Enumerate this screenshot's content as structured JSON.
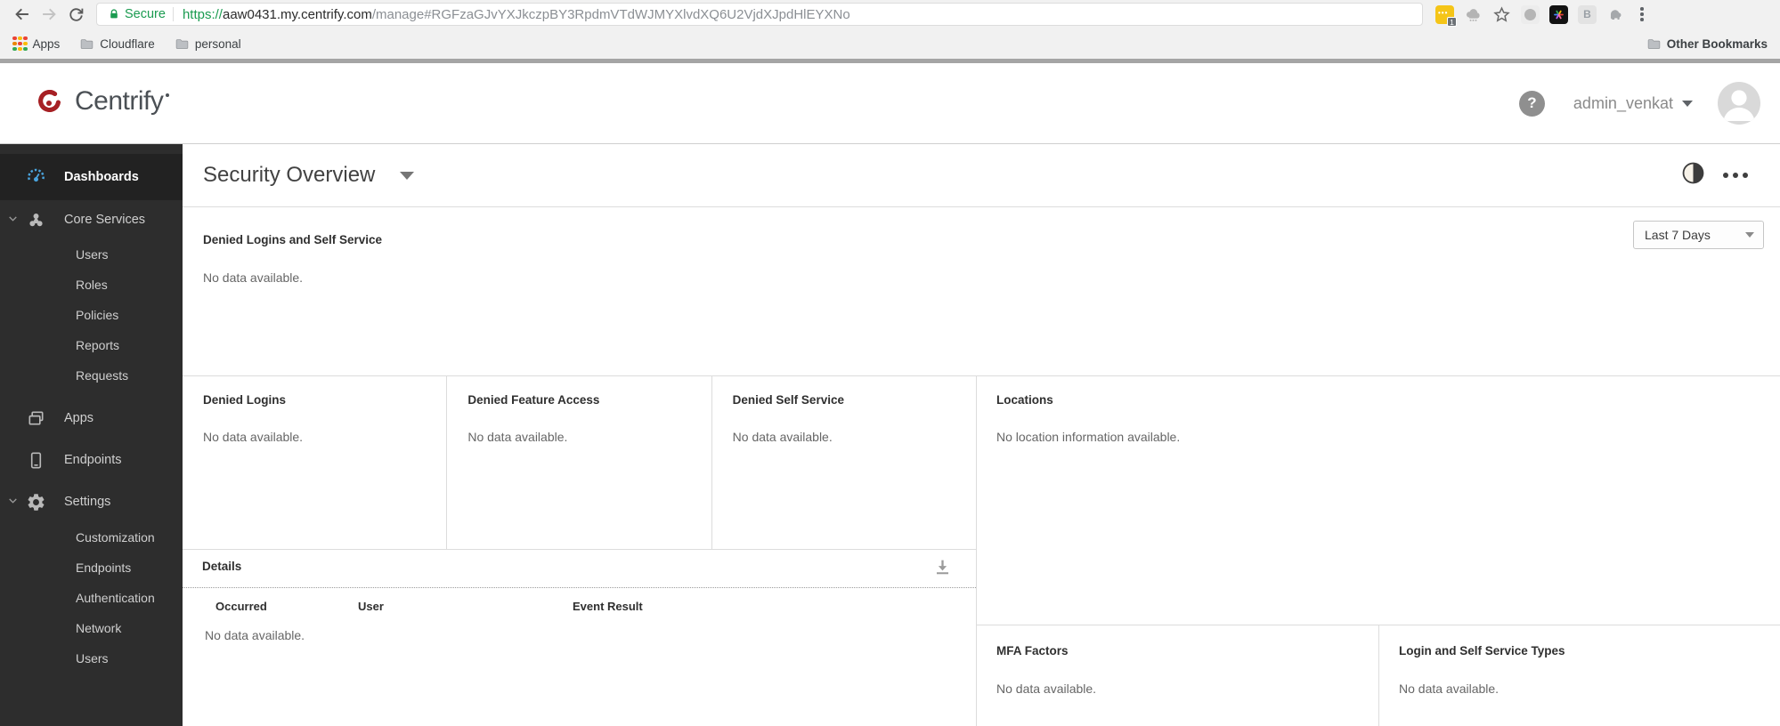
{
  "browser": {
    "secure_label": "Secure",
    "url": {
      "scheme": "https://",
      "host": "aaw0431.my.centrify.com",
      "path": "/manage#RGFzaGJvYXJkczpBY3RpdmVTdWJMYXlvdXQ6U2VjdXJpdHlEYXNo"
    },
    "extensions": {
      "badge_count": "1",
      "b_label": "B"
    },
    "bookmarks_bar": {
      "items": [
        {
          "label": "Apps"
        },
        {
          "label": "Cloudflare"
        },
        {
          "label": "personal"
        }
      ],
      "other_bookmarks_label": "Other Bookmarks"
    }
  },
  "app_header": {
    "brand": "Centrify",
    "help_glyph": "?",
    "username": "admin_venkat"
  },
  "sidebar": {
    "dashboards_label": "Dashboards",
    "core_services": {
      "label": "Core Services",
      "children": [
        "Users",
        "Roles",
        "Policies",
        "Reports",
        "Requests"
      ]
    },
    "apps_label": "Apps",
    "endpoints_label": "Endpoints",
    "settings": {
      "label": "Settings",
      "children": [
        "Customization",
        "Endpoints",
        "Authentication",
        "Network",
        "Users"
      ]
    }
  },
  "main": {
    "title": "Security Overview",
    "denied_logins_self_service": {
      "title": "Denied Logins and Self Service",
      "empty": "No data available.",
      "time_range": "Last 7 Days"
    },
    "mini_panels": [
      {
        "title": "Denied Logins",
        "empty": "No data available."
      },
      {
        "title": "Denied Feature Access",
        "empty": "No data available."
      },
      {
        "title": "Denied Self Service",
        "empty": "No data available."
      }
    ],
    "locations": {
      "title": "Locations",
      "empty": "No location information available."
    },
    "details": {
      "title": "Details",
      "columns": [
        "Occurred",
        "User",
        "Event Result"
      ],
      "empty": "No data available."
    },
    "bottom_panels": [
      {
        "title": "MFA Factors",
        "empty": "No data available."
      },
      {
        "title": "Login and Self Service Types",
        "empty": "No data available."
      }
    ]
  },
  "colors": {
    "accent_blue": "#4aa4de",
    "brand_red": "#a62024",
    "secure_green": "#1a9b50",
    "sidebar_bg": "#2d2d2d"
  }
}
